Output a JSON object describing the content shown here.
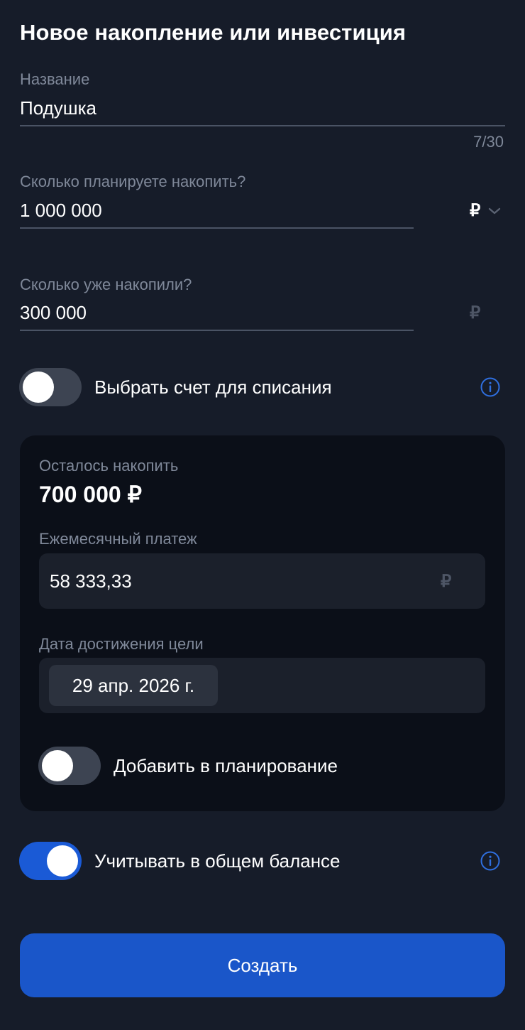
{
  "header": {
    "title": "Новое накопление или инвестиция"
  },
  "name_field": {
    "label": "Название",
    "value": "Подушка",
    "counter": "7/30"
  },
  "target_field": {
    "label": "Сколько планируете накопить?",
    "value": "1 000 000",
    "currency": "₽"
  },
  "saved_field": {
    "label": "Сколько уже накопили?",
    "value": "300 000",
    "currency": "₽"
  },
  "account_toggle": {
    "label": "Выбрать счет для списания",
    "on": false
  },
  "summary": {
    "remaining_label": "Осталось накопить",
    "remaining_value": "700 000 ₽",
    "monthly_label": "Ежемесячный платеж",
    "monthly_value": "58 333,33",
    "monthly_currency": "₽",
    "date_label": "Дата достижения цели",
    "date_value": "29 апр. 2026 г.",
    "planning_toggle_label": "Добавить в планирование",
    "planning_on": false
  },
  "balance_toggle": {
    "label": "Учитывать в общем балансе",
    "on": true
  },
  "create_button": {
    "label": "Создать"
  },
  "colors": {
    "background": "#161c29",
    "card": "#0b0f18",
    "accent": "#1a56c9",
    "info": "#2f6fe0"
  },
  "icons": [
    "chevron-down-icon",
    "info-icon"
  ]
}
